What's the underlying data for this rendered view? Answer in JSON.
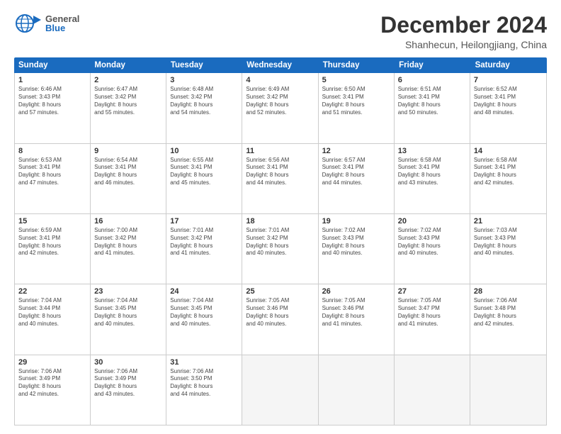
{
  "header": {
    "logo_general": "General",
    "logo_blue": "Blue",
    "month_title": "December 2024",
    "location": "Shanhecun, Heilongjiang, China"
  },
  "calendar": {
    "days_of_week": [
      "Sunday",
      "Monday",
      "Tuesday",
      "Wednesday",
      "Thursday",
      "Friday",
      "Saturday"
    ],
    "weeks": [
      [
        {
          "day": "1",
          "info": "Sunrise: 6:46 AM\nSunset: 3:43 PM\nDaylight: 8 hours\nand 57 minutes."
        },
        {
          "day": "2",
          "info": "Sunrise: 6:47 AM\nSunset: 3:42 PM\nDaylight: 8 hours\nand 55 minutes."
        },
        {
          "day": "3",
          "info": "Sunrise: 6:48 AM\nSunset: 3:42 PM\nDaylight: 8 hours\nand 54 minutes."
        },
        {
          "day": "4",
          "info": "Sunrise: 6:49 AM\nSunset: 3:42 PM\nDaylight: 8 hours\nand 52 minutes."
        },
        {
          "day": "5",
          "info": "Sunrise: 6:50 AM\nSunset: 3:41 PM\nDaylight: 8 hours\nand 51 minutes."
        },
        {
          "day": "6",
          "info": "Sunrise: 6:51 AM\nSunset: 3:41 PM\nDaylight: 8 hours\nand 50 minutes."
        },
        {
          "day": "7",
          "info": "Sunrise: 6:52 AM\nSunset: 3:41 PM\nDaylight: 8 hours\nand 48 minutes."
        }
      ],
      [
        {
          "day": "8",
          "info": "Sunrise: 6:53 AM\nSunset: 3:41 PM\nDaylight: 8 hours\nand 47 minutes."
        },
        {
          "day": "9",
          "info": "Sunrise: 6:54 AM\nSunset: 3:41 PM\nDaylight: 8 hours\nand 46 minutes."
        },
        {
          "day": "10",
          "info": "Sunrise: 6:55 AM\nSunset: 3:41 PM\nDaylight: 8 hours\nand 45 minutes."
        },
        {
          "day": "11",
          "info": "Sunrise: 6:56 AM\nSunset: 3:41 PM\nDaylight: 8 hours\nand 44 minutes."
        },
        {
          "day": "12",
          "info": "Sunrise: 6:57 AM\nSunset: 3:41 PM\nDaylight: 8 hours\nand 44 minutes."
        },
        {
          "day": "13",
          "info": "Sunrise: 6:58 AM\nSunset: 3:41 PM\nDaylight: 8 hours\nand 43 minutes."
        },
        {
          "day": "14",
          "info": "Sunrise: 6:58 AM\nSunset: 3:41 PM\nDaylight: 8 hours\nand 42 minutes."
        }
      ],
      [
        {
          "day": "15",
          "info": "Sunrise: 6:59 AM\nSunset: 3:41 PM\nDaylight: 8 hours\nand 42 minutes."
        },
        {
          "day": "16",
          "info": "Sunrise: 7:00 AM\nSunset: 3:42 PM\nDaylight: 8 hours\nand 41 minutes."
        },
        {
          "day": "17",
          "info": "Sunrise: 7:01 AM\nSunset: 3:42 PM\nDaylight: 8 hours\nand 41 minutes."
        },
        {
          "day": "18",
          "info": "Sunrise: 7:01 AM\nSunset: 3:42 PM\nDaylight: 8 hours\nand 40 minutes."
        },
        {
          "day": "19",
          "info": "Sunrise: 7:02 AM\nSunset: 3:43 PM\nDaylight: 8 hours\nand 40 minutes."
        },
        {
          "day": "20",
          "info": "Sunrise: 7:02 AM\nSunset: 3:43 PM\nDaylight: 8 hours\nand 40 minutes."
        },
        {
          "day": "21",
          "info": "Sunrise: 7:03 AM\nSunset: 3:43 PM\nDaylight: 8 hours\nand 40 minutes."
        }
      ],
      [
        {
          "day": "22",
          "info": "Sunrise: 7:04 AM\nSunset: 3:44 PM\nDaylight: 8 hours\nand 40 minutes."
        },
        {
          "day": "23",
          "info": "Sunrise: 7:04 AM\nSunset: 3:45 PM\nDaylight: 8 hours\nand 40 minutes."
        },
        {
          "day": "24",
          "info": "Sunrise: 7:04 AM\nSunset: 3:45 PM\nDaylight: 8 hours\nand 40 minutes."
        },
        {
          "day": "25",
          "info": "Sunrise: 7:05 AM\nSunset: 3:46 PM\nDaylight: 8 hours\nand 40 minutes."
        },
        {
          "day": "26",
          "info": "Sunrise: 7:05 AM\nSunset: 3:46 PM\nDaylight: 8 hours\nand 41 minutes."
        },
        {
          "day": "27",
          "info": "Sunrise: 7:05 AM\nSunset: 3:47 PM\nDaylight: 8 hours\nand 41 minutes."
        },
        {
          "day": "28",
          "info": "Sunrise: 7:06 AM\nSunset: 3:48 PM\nDaylight: 8 hours\nand 42 minutes."
        }
      ],
      [
        {
          "day": "29",
          "info": "Sunrise: 7:06 AM\nSunset: 3:49 PM\nDaylight: 8 hours\nand 42 minutes."
        },
        {
          "day": "30",
          "info": "Sunrise: 7:06 AM\nSunset: 3:49 PM\nDaylight: 8 hours\nand 43 minutes."
        },
        {
          "day": "31",
          "info": "Sunrise: 7:06 AM\nSunset: 3:50 PM\nDaylight: 8 hours\nand 44 minutes."
        },
        {
          "day": "",
          "info": ""
        },
        {
          "day": "",
          "info": ""
        },
        {
          "day": "",
          "info": ""
        },
        {
          "day": "",
          "info": ""
        }
      ]
    ]
  }
}
